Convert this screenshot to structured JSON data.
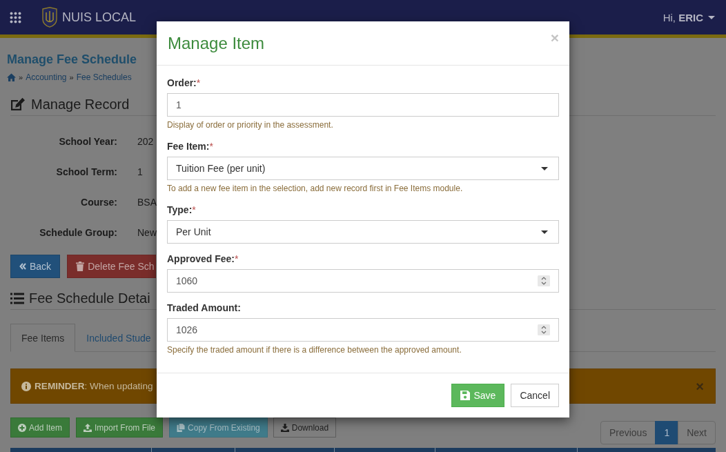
{
  "header": {
    "app_name": "NUIS LOCAL",
    "greeting": "Hi, **ERIC**"
  },
  "page": {
    "title": "Manage Fee Schedule",
    "breadcrumb": [
      {
        "separator": "»",
        "label": "Accounting"
      },
      {
        "separator": "»",
        "label": "Fee Schedules"
      }
    ]
  },
  "record": {
    "heading": "Manage Record",
    "fields": [
      {
        "label": "School Year:",
        "value": "202"
      },
      {
        "label": "School Term:",
        "value": "1"
      },
      {
        "label": "Course:",
        "value": "BSA"
      },
      {
        "label": "Schedule Group:",
        "value": "New"
      }
    ],
    "buttons": [
      {
        "label": "Back",
        "kind": "primary"
      },
      {
        "label": "Delete Fee Sch",
        "kind": "danger"
      }
    ]
  },
  "details": {
    "heading": "Fee Schedule Detai",
    "tabs": [
      {
        "label": "Fee Items",
        "selected": true
      },
      {
        "label": "Included Stude",
        "selected": false
      }
    ],
    "alert": {
      "text": "**REMINDER**: When updating",
      "close": "×"
    },
    "actions": [
      {
        "label": "Add Item",
        "kind": "success",
        "disabled": false
      },
      {
        "label": "Import From File",
        "kind": "success",
        "disabled": false
      },
      {
        "label": "Copy From Existing",
        "kind": "info",
        "disabled": true
      },
      {
        "label": "Download",
        "kind": "default",
        "disabled": false
      }
    ],
    "pagination": [
      {
        "label": "Previous",
        "selected": false
      },
      {
        "label": "1",
        "selected": true
      },
      {
        "label": "Next",
        "selected": false
      }
    ]
  },
  "modal": {
    "title": "Manage Item",
    "close": "×",
    "fields": [
      {
        "label": "Order:",
        "mark": "*",
        "kind": "text",
        "value": "1",
        "help": "Display of order or priority in the assessment."
      },
      {
        "label": "Fee Item:",
        "mark": "*",
        "kind": "select",
        "value": "Tuition Fee (per unit)",
        "help": "To add a new fee item in the selection, add new record first in Fee Items module."
      },
      {
        "label": "Type:",
        "mark": "*",
        "kind": "select",
        "value": "Per Unit"
      },
      {
        "label": "Approved Fee:",
        "mark": "*",
        "kind": "number",
        "value": "1060"
      },
      {
        "label": "Traded Amount:",
        "kind": "number",
        "value": "1026",
        "help": "Specify the traded amount if there is a difference between the approved amount."
      }
    ],
    "buttons": [
      {
        "label": "Save",
        "kind": "success"
      },
      {
        "label": "Cancel",
        "kind": "default"
      }
    ]
  }
}
